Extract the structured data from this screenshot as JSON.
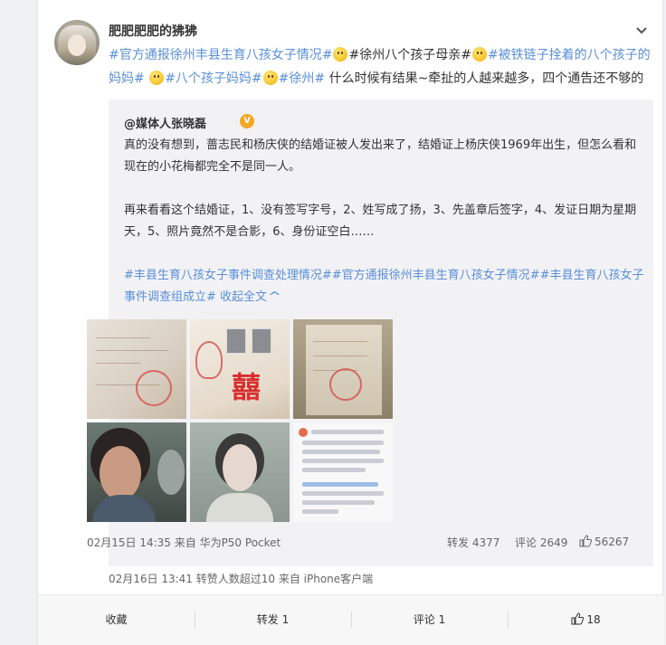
{
  "post": {
    "username": "肥肥肥肥的狒狒",
    "text": {
      "topic1": "#官方通报徐州丰县生育八孩女子情况#",
      "topic2": "#徐州八个孩子母亲#",
      "topic3": "#被铁链子拴着的八个孩子的妈妈#",
      "topic4": "#八个孩子妈妈#",
      "topic5": "#徐州#",
      "body": " 什么时候有结果~牵扯的人越来越多，四个通告还不够的"
    },
    "meta": "02月16日 13:41 转赞人数超过10  来自 iPhone客户端"
  },
  "repost": {
    "author": "@媒体人张晓磊",
    "badge": "V",
    "para1": "真的没有想到，蔷志民和杨庆侠的结婚证被人发出来了，结婚证上杨庆侠1969年出生，但怎么看和现在的小花梅都完全不是同一人。",
    "para2": "再来看看这个结婚证，1、没有签写字号，2、姓写成了扬，3、先盖章后签字，4、发证日期为星期天，5、照片竟然不是合影，6、身份证空白……",
    "topics": "#丰县生育八孩女子事件调查处理情况##官方通报徐州丰县生育八孩女子情况##丰县生育八孩女子事件调查组成立#",
    "collapse": " 收起全文",
    "collapse_caret": "^",
    "time": "02月15日 14:35 来自 华为P50 Pocket",
    "forward": "转发 4377",
    "comment": "评论 2649",
    "likes": "56267"
  },
  "actions": {
    "favorite": "收藏",
    "forward": "转发 1",
    "comment": "评论 1",
    "like": "18"
  },
  "colors": {
    "topic_orange": "#eb7350",
    "topic_blue": "#5a8ed8",
    "badge": "#f5a623"
  }
}
